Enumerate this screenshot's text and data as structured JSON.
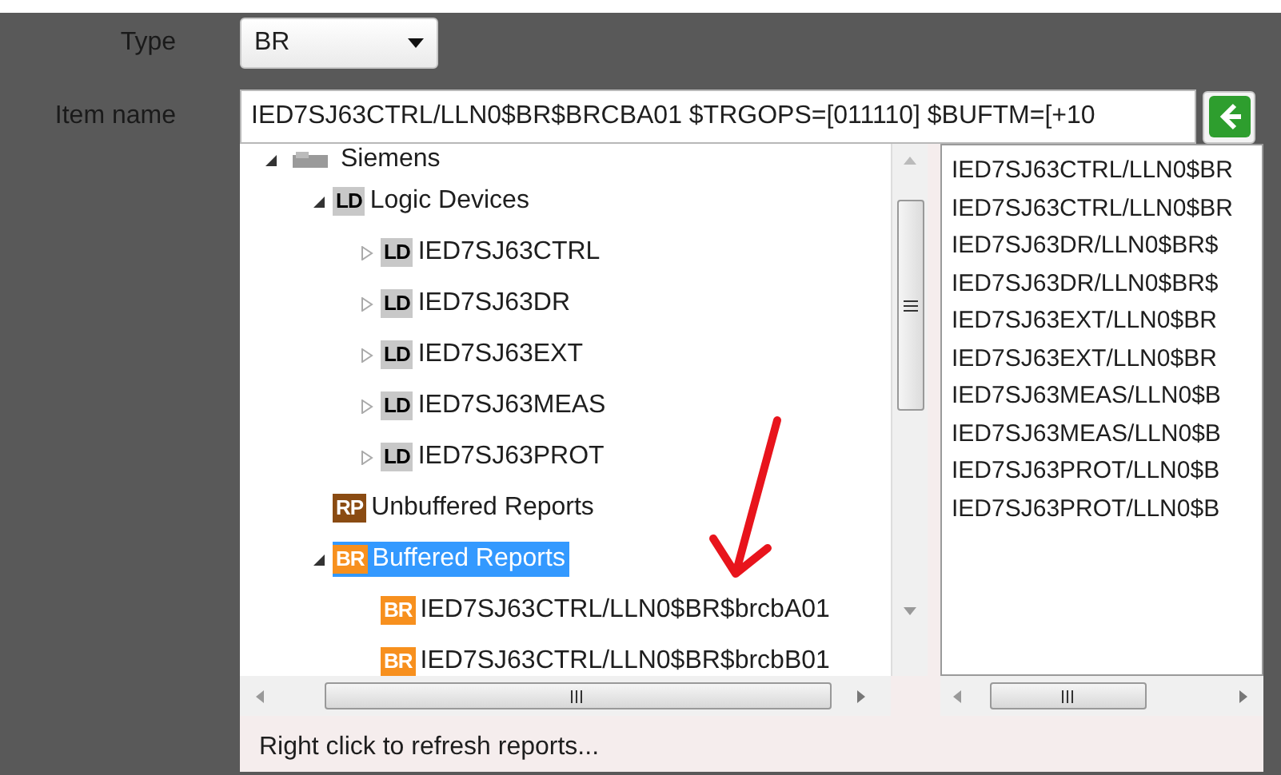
{
  "type_field": {
    "label": "Type",
    "value": "BR"
  },
  "item_name": {
    "label": "Item name",
    "value": "IED7SJ63CTRL/LLN0$BR$BRCBA01 $TRGOPS=[011110] $BUFTM=[+10"
  },
  "tree": [
    {
      "kind": "vendor",
      "label": "Siemens",
      "expanded": true,
      "selected": false,
      "children": [
        {
          "kind": "LD",
          "badge": "LD",
          "label": "Logic Devices",
          "expanded": true,
          "selected": false,
          "children": [
            {
              "kind": "LD",
              "badge": "LD",
              "label": "IED7SJ63CTRL",
              "expanded": false,
              "selected": false
            },
            {
              "kind": "LD",
              "badge": "LD",
              "label": "IED7SJ63DR",
              "expanded": false,
              "selected": false
            },
            {
              "kind": "LD",
              "badge": "LD",
              "label": "IED7SJ63EXT",
              "expanded": false,
              "selected": false
            },
            {
              "kind": "LD",
              "badge": "LD",
              "label": "IED7SJ63MEAS",
              "expanded": false,
              "selected": false
            },
            {
              "kind": "LD",
              "badge": "LD",
              "label": "IED7SJ63PROT",
              "expanded": false,
              "selected": false
            }
          ]
        },
        {
          "kind": "RP",
          "badge": "RP",
          "label": "Unbuffered Reports",
          "selected": false
        },
        {
          "kind": "BR",
          "badge": "BR",
          "label": "Buffered Reports",
          "expanded": true,
          "selected": true,
          "children": [
            {
              "kind": "BR",
              "badge": "BR",
              "label": "IED7SJ63CTRL/LLN0$BR$brcbA01",
              "selected": false
            },
            {
              "kind": "BR",
              "badge": "BR",
              "label": "IED7SJ63CTRL/LLN0$BR$brcbB01",
              "selected": false
            }
          ]
        }
      ]
    }
  ],
  "report_list": [
    "IED7SJ63CTRL/LLN0$BR",
    "IED7SJ63CTRL/LLN0$BR",
    "IED7SJ63DR/LLN0$BR$",
    "IED7SJ63DR/LLN0$BR$",
    "IED7SJ63EXT/LLN0$BR",
    "IED7SJ63EXT/LLN0$BR",
    "IED7SJ63MEAS/LLN0$B",
    "IED7SJ63MEAS/LLN0$B",
    "IED7SJ63PROT/LLN0$B",
    "IED7SJ63PROT/LLN0$B"
  ],
  "hint": "Right click to refresh reports..."
}
